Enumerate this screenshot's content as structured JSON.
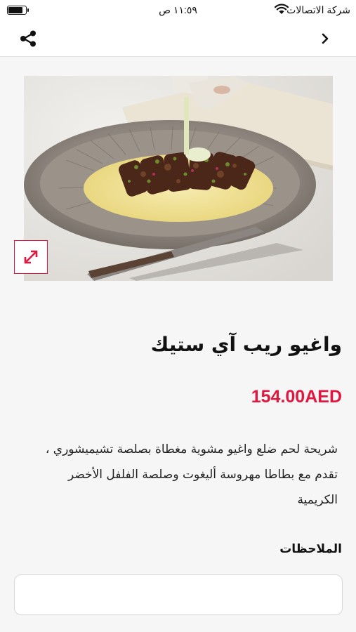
{
  "status_bar": {
    "carrier": "شركة الاتصالات",
    "time": "١١:٥٩ ص",
    "battery_level": 0.9
  },
  "nav": {
    "icons": {
      "back": "chevron-right-icon",
      "share": "share-icon"
    }
  },
  "product": {
    "image_alt": "wagyu-steak-photo",
    "expand_icon": "expand-icon",
    "title": "واغيو ريب آي ستيك",
    "price": "154.00AED",
    "description_lines": [
      "شريحة لحم ضلع واغيو مشوية مغطاة بصلصة تشيميشوري ،",
      "تقدم مع بطاطا مهروسة أليغوت وصلصة الفلفل الأخضر",
      "الكريمية"
    ]
  },
  "notes": {
    "label": "الملاحظات",
    "value": "",
    "placeholder": ""
  },
  "colors": {
    "accent": "#e0183f",
    "background": "#f6f6f6",
    "surface": "#ffffff"
  }
}
